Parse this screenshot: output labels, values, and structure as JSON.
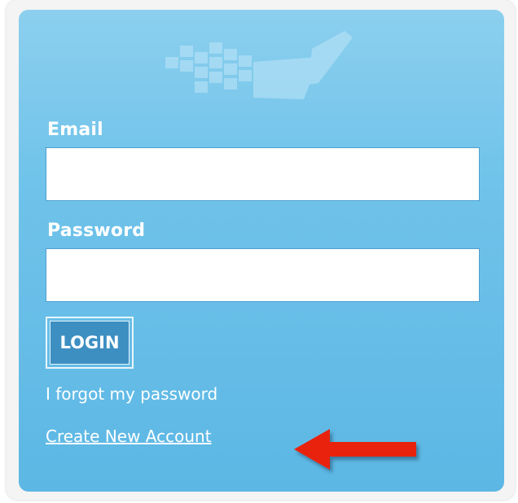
{
  "login_form": {
    "email_label": "Email",
    "email_value": "",
    "password_label": "Password",
    "password_value": "",
    "login_button_label": "LOGIN",
    "forgot_password_link": "I forgot my password",
    "create_account_link": "Create New Account"
  },
  "annotations": {
    "arrow": {
      "icon": "arrow-left-icon",
      "color": "#e8230f",
      "points_to": "create-account-link"
    }
  },
  "colors": {
    "panel_top": "#8ccfee",
    "panel_bottom": "#5cb7e4",
    "login_button": "#3d8fc2",
    "text": "#ffffff"
  }
}
